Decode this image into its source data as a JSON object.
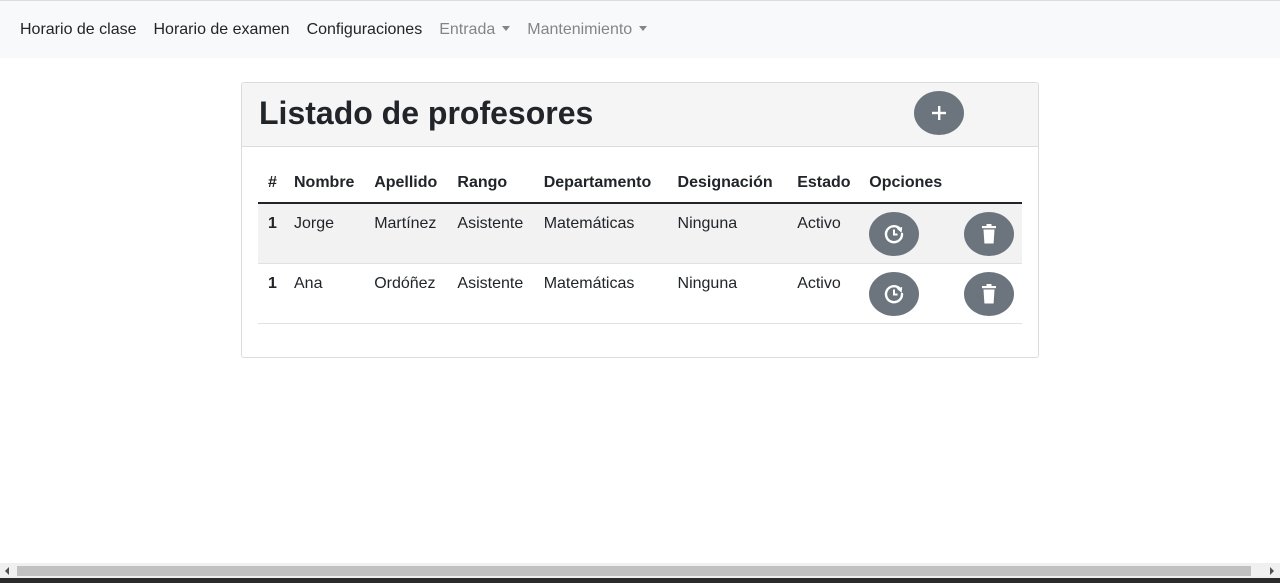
{
  "nav": {
    "items": [
      {
        "label": "Horario de clase"
      },
      {
        "label": "Horario de examen"
      },
      {
        "label": "Configuraciones"
      },
      {
        "label": "Entrada"
      },
      {
        "label": "Mantenimiento"
      }
    ]
  },
  "card": {
    "title": "Listado de profesores",
    "add_icon": "plus-icon"
  },
  "table": {
    "headers": [
      "#",
      "Nombre",
      "Apellido",
      "Rango",
      "Departamento",
      "Designación",
      "Estado",
      "Opciones"
    ],
    "rows": [
      {
        "idx": "1",
        "nombre": "Jorge",
        "apellido": "Martínez",
        "rango": "Asistente",
        "departamento": "Matemáticas",
        "designacion": "Ninguna",
        "estado": "Activo"
      },
      {
        "idx": "1",
        "nombre": "Ana",
        "apellido": "Ordóñez",
        "rango": "Asistente",
        "departamento": "Matemáticas",
        "designacion": "Ninguna",
        "estado": "Activo"
      }
    ],
    "row_actions": [
      "history-icon",
      "trash-icon"
    ]
  },
  "colors": {
    "navbar_bg": "#f8f9fa",
    "button_bg": "#6c757d",
    "stripe": "#f2f2f2"
  }
}
